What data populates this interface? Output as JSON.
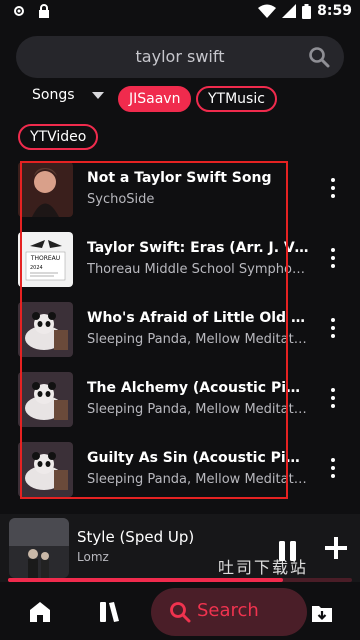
{
  "status_bar": {
    "time": "8:59"
  },
  "search": {
    "query": "taylor swift"
  },
  "filters": {
    "type_label": "Songs",
    "chips": [
      {
        "label": "JISaavn",
        "active": true
      },
      {
        "label": "YTMusic",
        "active": false
      },
      {
        "label": "YTVideo",
        "active": false
      }
    ]
  },
  "results": [
    {
      "title": "Not a Taylor Swift Song",
      "artist": "SychoSide"
    },
    {
      "title": "Taylor Swift: Eras (Arr. J. Vinson)",
      "artist": "Thoreau Middle School Symphonic Band"
    },
    {
      "title": "Who's Afraid of Little Old Me? (Acoustic Piano)",
      "artist": "Sleeping Panda, Mellow Meditation"
    },
    {
      "title": "The Alchemy (Acoustic Piano Version)",
      "artist": "Sleeping Panda, Mellow Meditation"
    },
    {
      "title": "Guilty As Sin (Acoustic Piano Version)",
      "artist": "Sleeping Panda, Mellow Meditation"
    }
  ],
  "album_text": {
    "thoreau": "THOREAU",
    "year": "2024"
  },
  "now_playing": {
    "title": "Style (Sped Up)",
    "artist": "Lomz",
    "progress": 0.8
  },
  "watermark": "吐司下载站",
  "bottom_nav": {
    "search_label": "Search"
  },
  "colors": {
    "accent": "#f02b4d",
    "background": "#0f0f11"
  }
}
